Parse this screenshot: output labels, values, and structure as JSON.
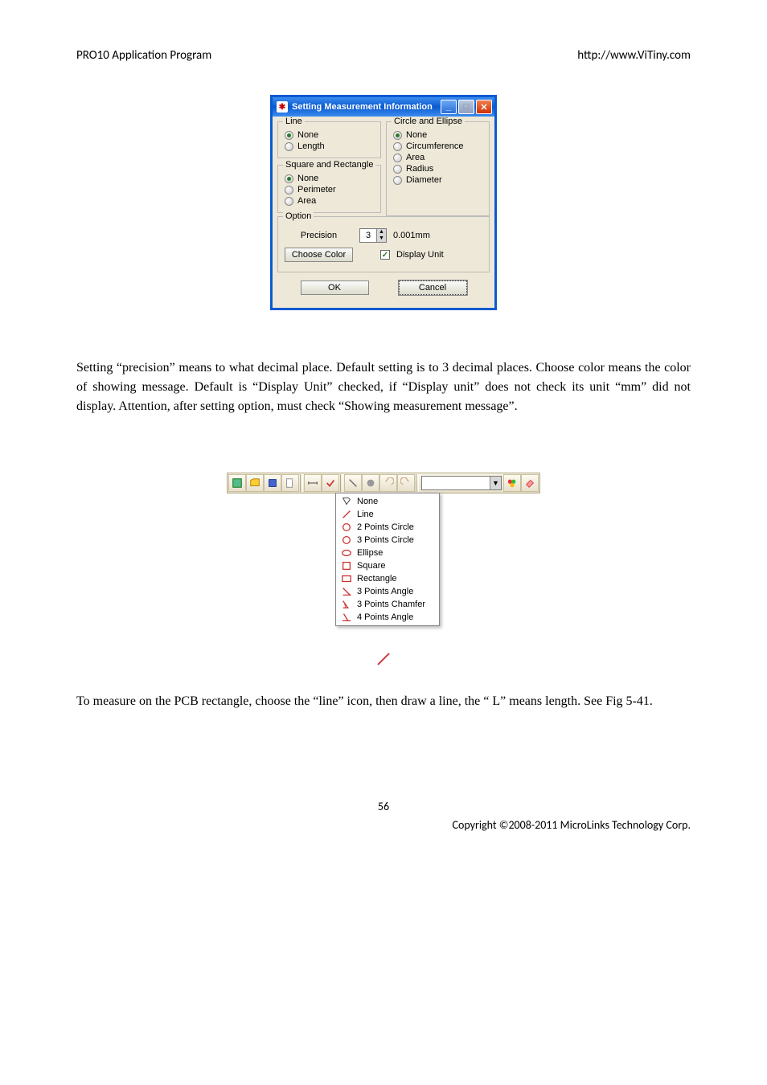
{
  "header": {
    "left": "PRO10 Application Program",
    "right": "http://www.ViTiny.com"
  },
  "dialog": {
    "title": "Setting Measurement Information",
    "groups": {
      "line": {
        "legend": "Line",
        "options": [
          "None",
          "Length"
        ],
        "selected": 0
      },
      "square": {
        "legend": "Square and Rectangle",
        "options": [
          "None",
          "Perimeter",
          "Area"
        ],
        "selected": 0
      },
      "circle": {
        "legend": "Circle and Ellipse",
        "options": [
          "None",
          "Circumference",
          "Area",
          "Radius",
          "Diameter"
        ],
        "selected": 0
      },
      "option": {
        "legend": "Option",
        "precision_label": "Precision",
        "precision_value": "3",
        "precision_unit": "0.001mm",
        "choose_color": "Choose Color",
        "display_unit_label": "Display Unit",
        "display_unit_checked": true
      }
    },
    "buttons": {
      "ok": "OK",
      "cancel": "Cancel"
    }
  },
  "body_text_1": "Setting “precision” means to what decimal place. Default setting is to 3 decimal places. Choose color means the color of showing message. Default is “Display Unit” checked, if “Display unit” does not check its unit “mm” did not display. Attention, after setting option, must check “Showing measurement message”.",
  "dropdown": {
    "items": [
      "None",
      "Line",
      "2 Points Circle",
      "3 Points Circle",
      "Ellipse",
      "Square",
      "Rectangle",
      "3 Points Angle",
      "3 Points Chamfer",
      "4 Points Angle"
    ]
  },
  "body_text_2": "To measure on the PCB rectangle, choose the “line” icon, then draw a line, the “ L” means length. See Fig 5-41.",
  "page_number": "56",
  "footer": "Copyright ©2008-2011 MicroLinks Technology Corp."
}
